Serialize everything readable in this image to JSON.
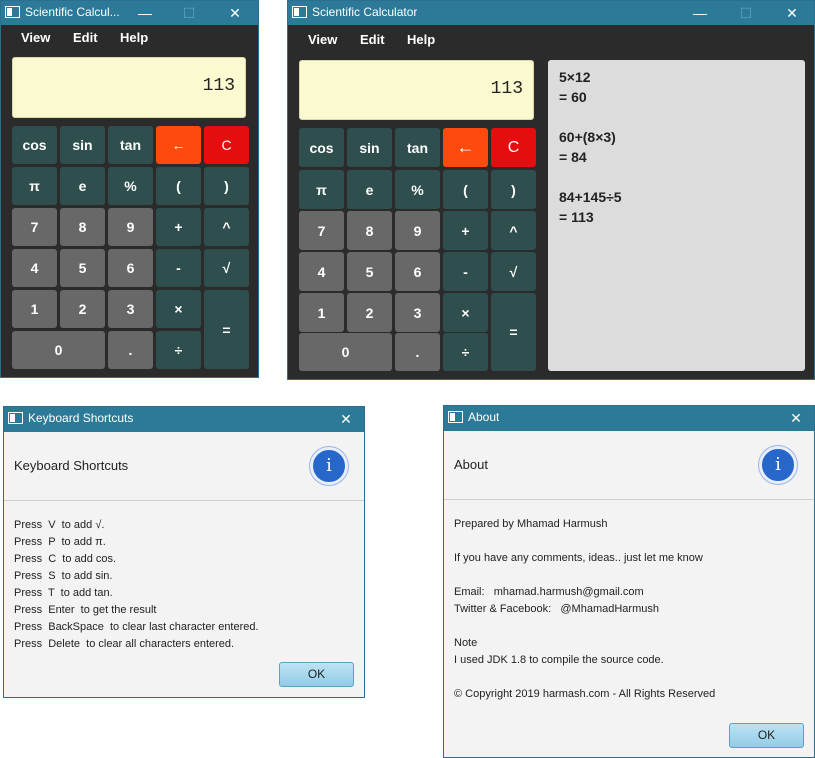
{
  "calc_small": {
    "title": "Scientific Calcul...",
    "menu": [
      "View",
      "Edit",
      "Help"
    ],
    "display": "113"
  },
  "calc_large": {
    "title": "Scientific Calculator",
    "menu": [
      "View",
      "Edit",
      "Help"
    ],
    "display": "113",
    "history": [
      "5×12",
      "= 60",
      "",
      "60+(8×3)",
      "= 84",
      "",
      "84+145÷5",
      "= 113"
    ]
  },
  "keys": {
    "cos": "cos",
    "sin": "sin",
    "tan": "tan",
    "back": "←",
    "clear": "C",
    "pi": "π",
    "e": "e",
    "percent": "%",
    "lparen": "(",
    "rparen": ")",
    "seven": "7",
    "eight": "8",
    "nine": "9",
    "plus": "+",
    "power": "^",
    "four": "4",
    "five": "5",
    "six": "6",
    "minus": "-",
    "sqrt": "√",
    "one": "1",
    "two": "2",
    "three": "3",
    "multiply": "×",
    "equals": "=",
    "zero": "0",
    "dot": ".",
    "divide": "÷"
  },
  "shortcuts": {
    "title": "Keyboard Shortcuts",
    "header": "Keyboard Shortcuts",
    "lines": [
      "Press  V  to add √.",
      "Press  P  to add π.",
      "Press  C  to add cos.",
      "Press  S  to add sin.",
      "Press  T  to add tan.",
      "Press  Enter  to get the result",
      "Press  BackSpace  to clear last character entered.",
      "Press  Delete  to clear all characters entered."
    ],
    "ok": "OK"
  },
  "about": {
    "title": "About",
    "header": "About",
    "lines": [
      "Prepared by Mhamad Harmush",
      "",
      "If you have any comments, ideas.. just let me know",
      "",
      "Email:   mhamad.harmush@gmail.com",
      "Twitter & Facebook:   @MhamadHarmush",
      "",
      "Note",
      "I used JDK 1.8 to compile the source code.",
      "",
      "© Copyright 2019 harmash.com - All Rights Reserved"
    ],
    "ok": "OK"
  },
  "window_controls": {
    "minimize": "—",
    "maximize": "☐",
    "close": "✕"
  },
  "info_glyph": "i",
  "colors": {
    "titlebar": "#2c7a98",
    "window_bg": "#2b2b2b",
    "display_bg": "#fbf9cf",
    "key_dark": "#2f4f4f",
    "key_gray": "#686868",
    "key_backspace": "#ff4a0d",
    "key_clear": "#e50d0d",
    "history_bg": "#dcdcdc"
  }
}
